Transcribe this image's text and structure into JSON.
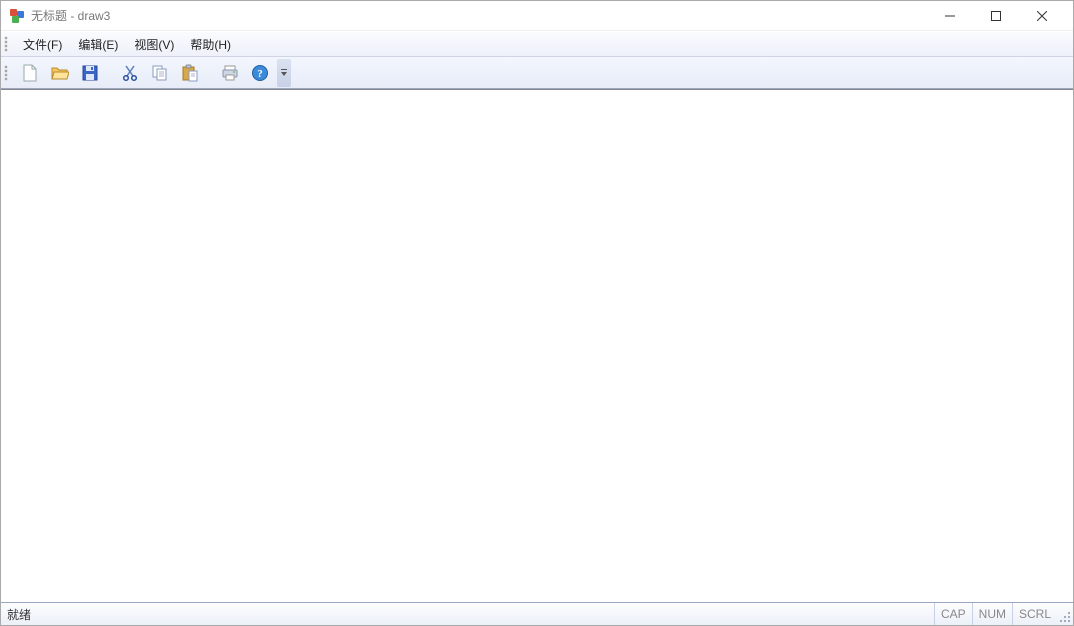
{
  "window": {
    "title": "无标题 - draw3"
  },
  "menu": {
    "items": [
      {
        "label": "文件(F)"
      },
      {
        "label": "编辑(E)"
      },
      {
        "label": "视图(V)"
      },
      {
        "label": "帮助(H)"
      }
    ]
  },
  "toolbar": {
    "buttons": [
      {
        "name": "new-file-icon"
      },
      {
        "name": "open-file-icon"
      },
      {
        "name": "save-file-icon"
      },
      {
        "name": "cut-icon"
      },
      {
        "name": "copy-icon"
      },
      {
        "name": "paste-icon"
      },
      {
        "name": "print-icon"
      },
      {
        "name": "help-icon"
      }
    ]
  },
  "status": {
    "ready": "就绪",
    "cap": "CAP",
    "num": "NUM",
    "scrl": "SCRL"
  }
}
